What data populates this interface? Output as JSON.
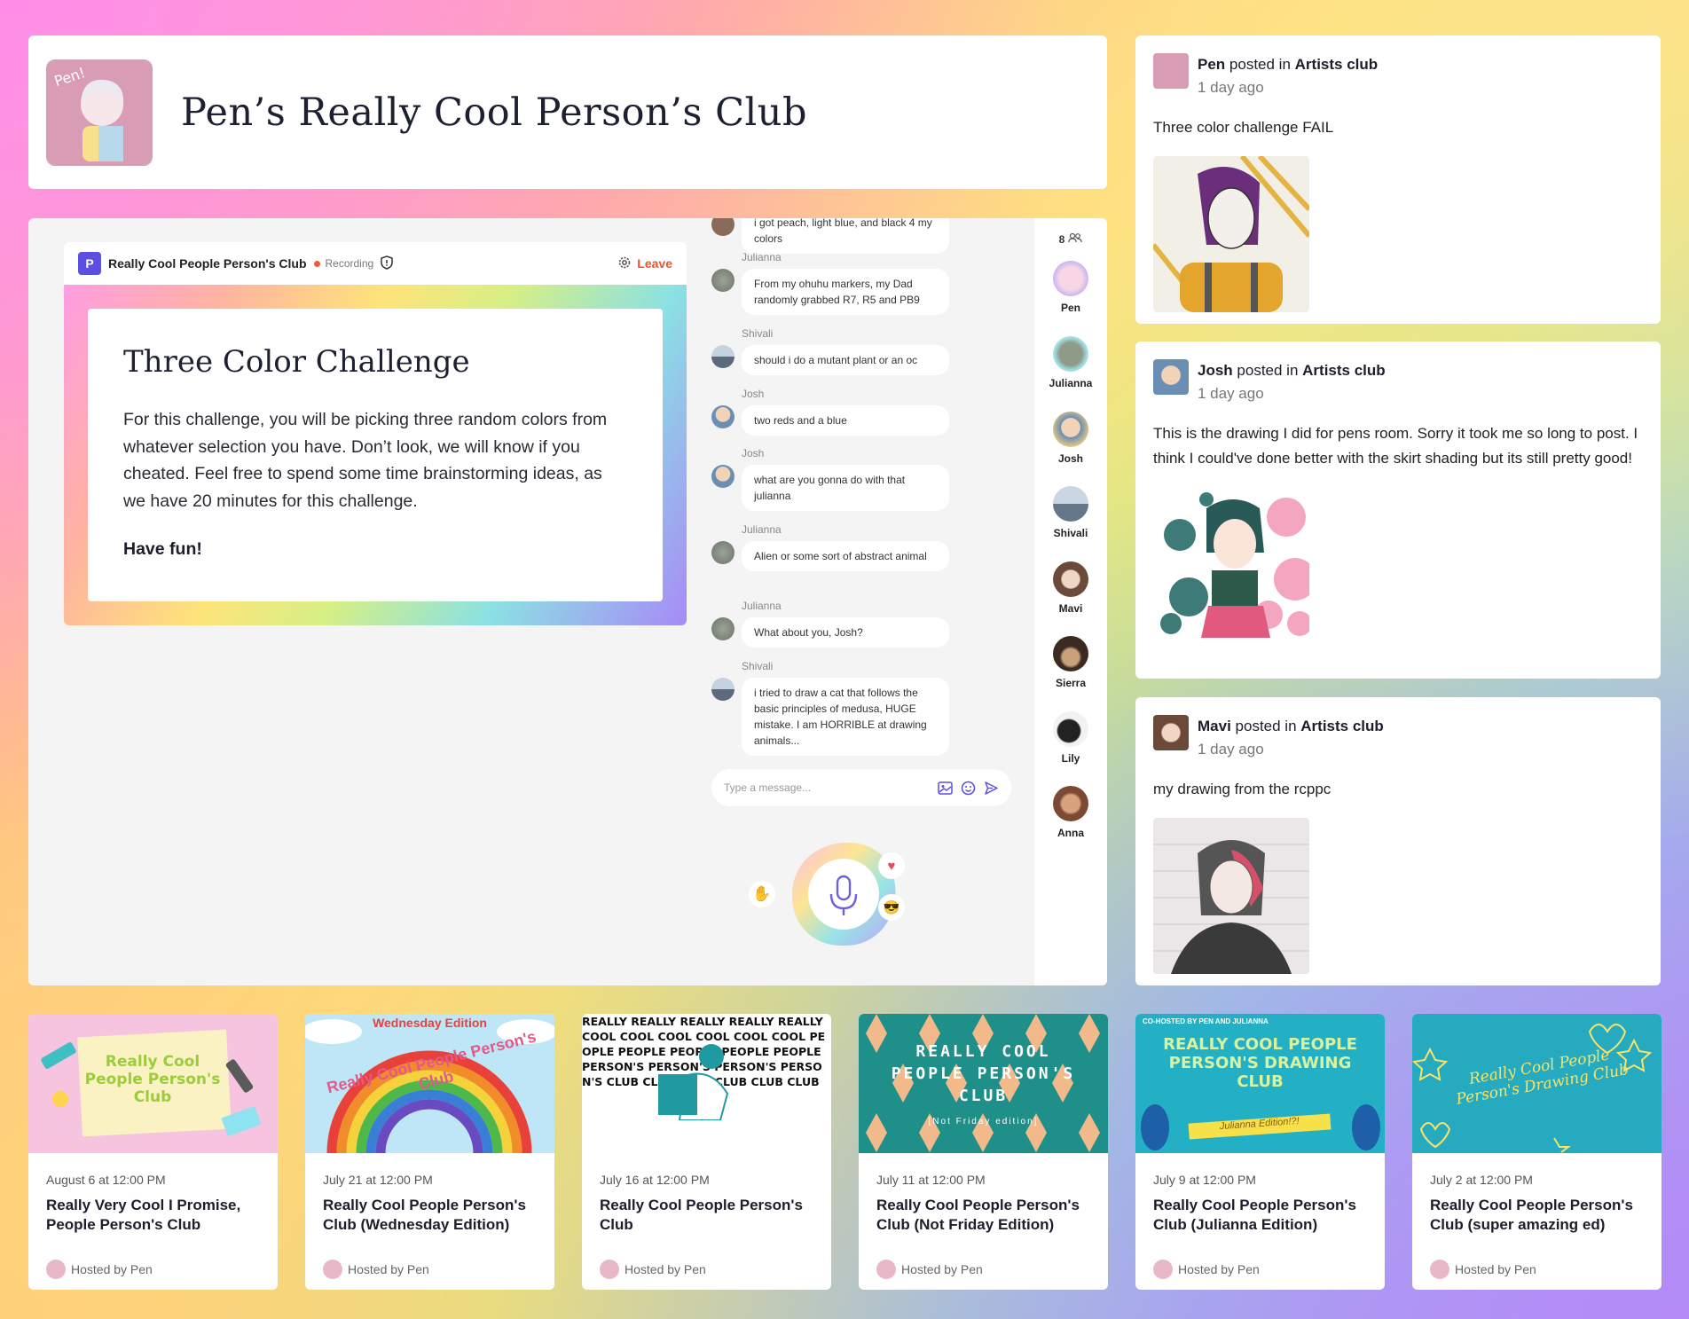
{
  "header": {
    "title": "Pen’s Really Cool Person’s Club"
  },
  "room": {
    "logo_letter": "P",
    "name": "Really Cool People Person's Club",
    "recording_label": "Recording",
    "leave_label": "Leave",
    "challenge": {
      "title": "Three Color Challenge",
      "body": "For this challenge, you will be picking three random colors from whatever selection you have. Don’t look, we will know if you cheated. Feel free to spend some time brainstorming ideas, as we have 20 minutes for this challenge.",
      "closing": "Have fun!"
    }
  },
  "chat": {
    "messages": [
      {
        "author": "",
        "text": "i got peach, light blue, and black 4 my colors"
      },
      {
        "author": "Julianna",
        "text": "From my ohuhu markers, my Dad randomly grabbed R7, R5 and PB9"
      },
      {
        "author": "Shivali",
        "text": "should i do a mutant plant or an oc"
      },
      {
        "author": "Josh",
        "text": "two reds and a blue"
      },
      {
        "author": "Josh",
        "text": "what are you gonna do with that julianna"
      },
      {
        "author": "Julianna",
        "text": "Alien or some sort of abstract animal"
      },
      {
        "author": "Julianna",
        "text": "What about you, Josh?"
      },
      {
        "author": "Shivali",
        "text": "i tried to draw a cat that follows the basic principles of medusa, HUGE mistake. I am HORRIBLE at drawing animals..."
      }
    ],
    "input_placeholder": "Type a message..."
  },
  "participants": {
    "count": "8",
    "people": [
      "Pen",
      "Julianna",
      "Josh",
      "Shivali",
      "Mavi",
      "Sierra",
      "Lily",
      "Anna"
    ]
  },
  "feed": [
    {
      "author": "Pen",
      "verb": "posted in",
      "group": "Artists club",
      "time": "1 day ago",
      "text": "Three color challenge FAIL"
    },
    {
      "author": "Josh",
      "verb": "posted in",
      "group": "Artists club",
      "time": "1 day ago",
      "text": "This is the drawing I did for pens room. Sorry it took me so long to post. I think I could've done better with the skirt shading but its still pretty good!"
    },
    {
      "author": "Mavi",
      "verb": "posted in",
      "group": "Artists club",
      "time": "1 day ago",
      "text": "my drawing from the rcppc"
    }
  ],
  "events": [
    {
      "date": "August 6 at 12:00 PM",
      "title": "Really Very Cool I Promise, People Person's Club",
      "host": "Hosted by Pen",
      "thumb_text": "Really Cool People Person's Club"
    },
    {
      "date": "July 21 at 12:00 PM",
      "title": "Really Cool People Person's Club (Wednesday Edition)",
      "host": "Hosted by Pen",
      "thumb_text": "Really Cool People Person's Club",
      "thumb_sub": "Wednesday Edition"
    },
    {
      "date": "July 16 at 12:00 PM",
      "title": "Really Cool People Person's Club",
      "host": "Hosted by Pen",
      "thumb_text": "REALLY REALLY REALLY REALLY REALLY COOL COOL COOL COOL COOL COOL PEOPLE PEOPLE PEOPLE PEOPLE PEOPLE PERSON'S PERSON'S PERSON'S PERSON'S CLUB CLUB CLUB CLUB CLUB CLUB"
    },
    {
      "date": "July 11 at 12:00 PM",
      "title": "Really Cool People Person's Club (Not Friday Edition)",
      "host": "Hosted by Pen",
      "thumb_text": "REALLY COOL PEOPLE PERSON'S CLUB",
      "thumb_sub": "[Not Friday edition]"
    },
    {
      "date": "July 9 at 12:00 PM",
      "title": "Really Cool People Person's Club (Julianna Edition)",
      "host": "Hosted by Pen",
      "thumb_text": "REALLY COOL PEOPLE PERSON'S DRAWING CLUB",
      "thumb_sub": "Julianna Edition!?!",
      "thumb_top": "CO-HOSTED BY PEN AND JULIANNA"
    },
    {
      "date": "July 2 at 12:00 PM",
      "title": "Really Cool People Person's Club (super amazing ed)",
      "host": "Hosted by Pen",
      "thumb_text": "Really Cool People Person's Drawing Club"
    }
  ],
  "colors": {
    "accent": "#5a4fe0",
    "leave": "#e8552d",
    "recording": "#ee5a3a"
  }
}
